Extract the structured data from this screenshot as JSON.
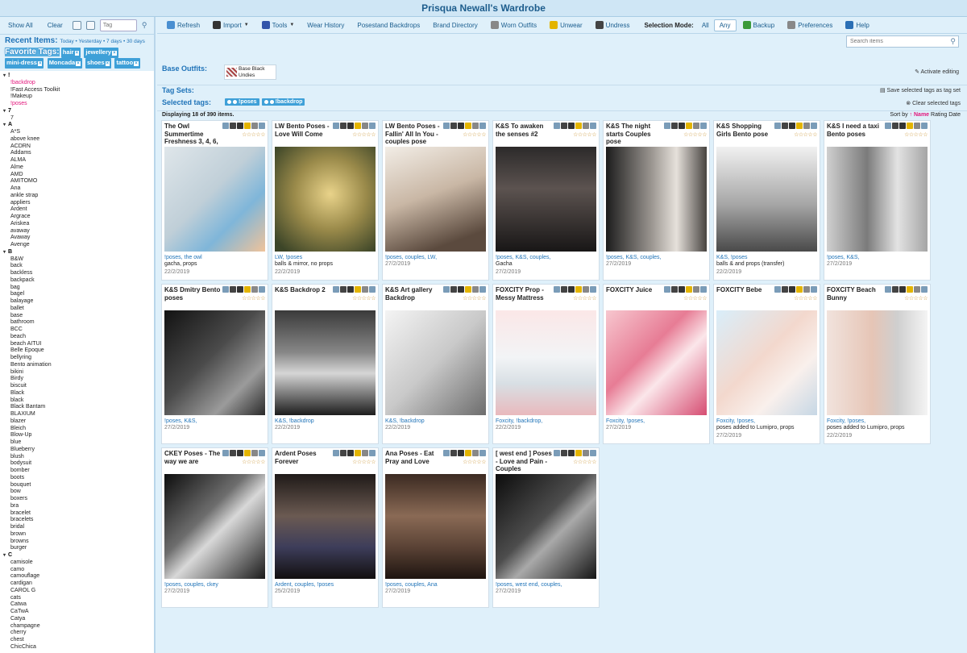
{
  "app_title": "Prisqua Newall's Wardrobe",
  "sidebar": {
    "show_all": "Show All",
    "clear": "Clear",
    "tag_placeholder": "Tag",
    "recent_label": "Recent Items:",
    "recent_links": "Today • Yesterday • 7 days • 30 days",
    "favorite_label": "Favorite Tags:",
    "favorite_tags": [
      "hair",
      "jewellery",
      "mini-dress",
      "Moncada",
      "shoes",
      "tattoo"
    ],
    "tags": [
      {
        "t": "!",
        "grp": true
      },
      {
        "t": "!backdrop",
        "pink": true
      },
      {
        "t": "!Fast Access Toolkit"
      },
      {
        "t": "!Makeup"
      },
      {
        "t": "!poses",
        "pink": true
      },
      {
        "t": "7",
        "grp": true
      },
      {
        "t": "7"
      },
      {
        "t": "A",
        "grp": true
      },
      {
        "t": "A*S"
      },
      {
        "t": "above knee"
      },
      {
        "t": "ACDRN"
      },
      {
        "t": "Addams"
      },
      {
        "t": "ALMA"
      },
      {
        "t": "Alme"
      },
      {
        "t": "AMD"
      },
      {
        "t": "AMITOMO"
      },
      {
        "t": "Ana"
      },
      {
        "t": "ankle strap"
      },
      {
        "t": "appliers"
      },
      {
        "t": "Ardent"
      },
      {
        "t": "Argrace"
      },
      {
        "t": "Ariskea"
      },
      {
        "t": "avaway"
      },
      {
        "t": "Avaway"
      },
      {
        "t": "Avenge"
      },
      {
        "t": "B",
        "grp": true
      },
      {
        "t": "B&W"
      },
      {
        "t": "back"
      },
      {
        "t": "backless"
      },
      {
        "t": "backpack"
      },
      {
        "t": "bag"
      },
      {
        "t": "bagel"
      },
      {
        "t": "balayage"
      },
      {
        "t": "ballet"
      },
      {
        "t": "base"
      },
      {
        "t": "bathroom"
      },
      {
        "t": "BCC"
      },
      {
        "t": "beach"
      },
      {
        "t": "beach AITUI"
      },
      {
        "t": "Belle Epoque"
      },
      {
        "t": "bellyring"
      },
      {
        "t": "Bento animation"
      },
      {
        "t": "bikini"
      },
      {
        "t": "Birdy"
      },
      {
        "t": "biscuit"
      },
      {
        "t": "Black"
      },
      {
        "t": "black"
      },
      {
        "t": "Black Bantam"
      },
      {
        "t": "BLAXIUM"
      },
      {
        "t": "blazer"
      },
      {
        "t": "Bleich"
      },
      {
        "t": "Blow-Up"
      },
      {
        "t": "blue"
      },
      {
        "t": "Blueberry"
      },
      {
        "t": "blush"
      },
      {
        "t": "bodysuit"
      },
      {
        "t": "bomber"
      },
      {
        "t": "boots"
      },
      {
        "t": "bouquet"
      },
      {
        "t": "bow"
      },
      {
        "t": "boxers"
      },
      {
        "t": "bra"
      },
      {
        "t": "bracelet"
      },
      {
        "t": "bracelets"
      },
      {
        "t": "bridal"
      },
      {
        "t": "brown"
      },
      {
        "t": "browns"
      },
      {
        "t": "burger"
      },
      {
        "t": "C",
        "grp": true
      },
      {
        "t": "camisole"
      },
      {
        "t": "camo"
      },
      {
        "t": "camouflage"
      },
      {
        "t": "cardigan"
      },
      {
        "t": "CAROL G"
      },
      {
        "t": "cats"
      },
      {
        "t": "Catwa"
      },
      {
        "t": "CaTwA"
      },
      {
        "t": "Catya"
      },
      {
        "t": "champagne"
      },
      {
        "t": "cherry"
      },
      {
        "t": "chest"
      },
      {
        "t": "ChicChica"
      }
    ]
  },
  "toolbar": {
    "items": [
      "Refresh",
      "Import",
      "Tools",
      "Wear History",
      "Posestand Backdrops",
      "Brand Directory",
      "Worn Outfits",
      "Unwear",
      "Undress"
    ],
    "selection_mode_label": "Selection Mode:",
    "mode_all": "All",
    "mode_any": "Any",
    "backup": "Backup",
    "preferences": "Preferences",
    "help": "Help"
  },
  "search_placeholder": "Search items",
  "base_outfits_label": "Base Outfits:",
  "base_outfit_name": "Base Black Undies",
  "activate_editing": "Activate editing",
  "tag_sets_label": "Tag Sets:",
  "save_tag_set": "Save selected tags as tag set",
  "selected_tags_label": "Selected tags:",
  "selected_tags": [
    "!poses",
    "!backdrop"
  ],
  "clear_selected": "Clear selected tags",
  "displaying": "Displaying 18 of 390 items.",
  "sort": {
    "label": "Sort by",
    "active": "Name",
    "rest": "Rating Date"
  },
  "stars": "☆☆☆☆☆",
  "items": [
    {
      "name": "The Owl Summertime Freshness 3, 4, 6,",
      "tags": "!poses, the owl",
      "note": "gacha, props",
      "date": "22/2/2019",
      "bg": "linear-gradient(135deg,#dfe6ea,#c0cfd8 45%,#7fb6d9 70%,#f0c39a)"
    },
    {
      "name": "LW Bento Poses - Love Will Come",
      "tags": "LW, !poses",
      "note": "balls & mirror, no props",
      "date": "22/2/2019",
      "bg": "radial-gradient(circle at 55% 45%,#e9d38a,#9a8a4a 45%,#3c4528 90%)"
    },
    {
      "name": "LW Bento Poses - Fallin' All In You - couples pose",
      "tags": "!poses, couples, LW,",
      "note": "",
      "date": "27/2/2019",
      "bg": "linear-gradient(160deg,#f2ede6,#c9b7a5 45%,#5b4a3e 85%)"
    },
    {
      "name": "K&S To awaken the senses #2",
      "tags": "!poses, K&S, couples,",
      "note": "Gacha",
      "date": "27/2/2019",
      "bg": "linear-gradient(180deg,#2c2a2a,#5c5350 40%,#181616)"
    },
    {
      "name": "K&S The night starts Couples pose",
      "tags": "!poses, K&S, couples,",
      "note": "",
      "date": "27/2/2019",
      "bg": "linear-gradient(90deg,#1c1c1c,#9a9590 45%,#e6e1db 70%,#474340)"
    },
    {
      "name": "K&S Shopping Girls Bento pose",
      "tags": "K&S, !poses",
      "note": "balls & and props (transfer)",
      "date": "22/2/2019",
      "bg": "linear-gradient(180deg,#f1f1f1,#a6a6a6 55%,#4a4a4a)"
    },
    {
      "name": "K&S I need a taxi Bento poses",
      "tags": "!poses, K&S,",
      "note": "",
      "date": "27/2/2019",
      "bg": "linear-gradient(90deg,#cfcfcf,#7b7b7b 40%,#e3e3e3 70%,#a5a5a5)"
    },
    {
      "name": "K&S Dmitry Bento poses",
      "tags": "!poses, K&S,",
      "note": "",
      "date": "27/2/2019",
      "bg": "linear-gradient(135deg,#121212,#4b4b4b 45%,#9b9b9b 75%,#2a2a2a)"
    },
    {
      "name": "K&S Backdrop 2",
      "tags": "K&S, !backdrop",
      "note": "",
      "date": "22/2/2019",
      "bg": "linear-gradient(180deg,#3a3a3a,#878787 40%,#d6d6d6 60%,#1d1d1d)"
    },
    {
      "name": "K&S Art gallery Backdrop",
      "tags": "K&S, !backdrop",
      "note": "",
      "date": "22/2/2019",
      "bg": "linear-gradient(135deg,#f4f4f4,#c9c9c9 50%,#6d6d6d)"
    },
    {
      "name": "FOXCITY Prop - Messy Mattress",
      "tags": "Foxcity, !backdrop,",
      "note": "",
      "date": "22/2/2019",
      "bg": "linear-gradient(180deg,#fbe7e7,#f2f4f6 45%,#d8dfe4 70%,#e9b9bd)"
    },
    {
      "name": "FOXCITY Juice",
      "tags": "Foxcity, !poses,",
      "note": "",
      "date": "27/2/2019",
      "bg": "linear-gradient(135deg,#f7c7cf,#e77c95 40%,#fbe6ea 60%,#d64d72)"
    },
    {
      "name": "FOXCITY Bebe",
      "tags": "Foxcity, !poses,",
      "note": "poses added to Lumipro, props",
      "date": "27/2/2019",
      "bg": "linear-gradient(135deg,#d9eefa,#f3d8cd 45%,#f9f0ec 70%,#c6d7e5)"
    },
    {
      "name": "FOXCITY Beach Bunny",
      "tags": "Foxcity, !poses,",
      "note": "poses added to Lumipro, props",
      "date": "22/2/2019",
      "bg": "linear-gradient(90deg,#f1e3dd,#e6c5b6 45%,#cfcfcf 70%,#f4f4f4)"
    },
    {
      "name": "CKEY Poses - The way we are",
      "tags": "!poses, couples, ckey",
      "note": "",
      "date": "27/2/2019",
      "bg": "linear-gradient(135deg,#0d0d0d,#6e6e6e 40%,#d8d8d8 55%,#1a1a1a)"
    },
    {
      "name": "Ardent Poses Forever",
      "tags": "Ardent, couples, !poses",
      "note": "",
      "date": "25/2/2019",
      "bg": "linear-gradient(180deg,#1f1a18,#6b5a52 40%,#3d3d5a 70%,#120f0f)"
    },
    {
      "name": "Ana Poses - Eat Pray and Love",
      "tags": "!poses, couples, Ana",
      "note": "",
      "date": "27/2/2019",
      "bg": "linear-gradient(180deg,#3b2a22,#8a6a55 40%,#5a4235 70%,#1e1410)"
    },
    {
      "name": "[ west end ] Poses - Love and Pain - Couples",
      "tags": "!poses, west end, couples,",
      "note": "",
      "date": "27/2/2019",
      "bg": "linear-gradient(135deg,#0c0c0c,#4d4d4d 45%,#a9a9a9 60%,#151515)"
    }
  ]
}
